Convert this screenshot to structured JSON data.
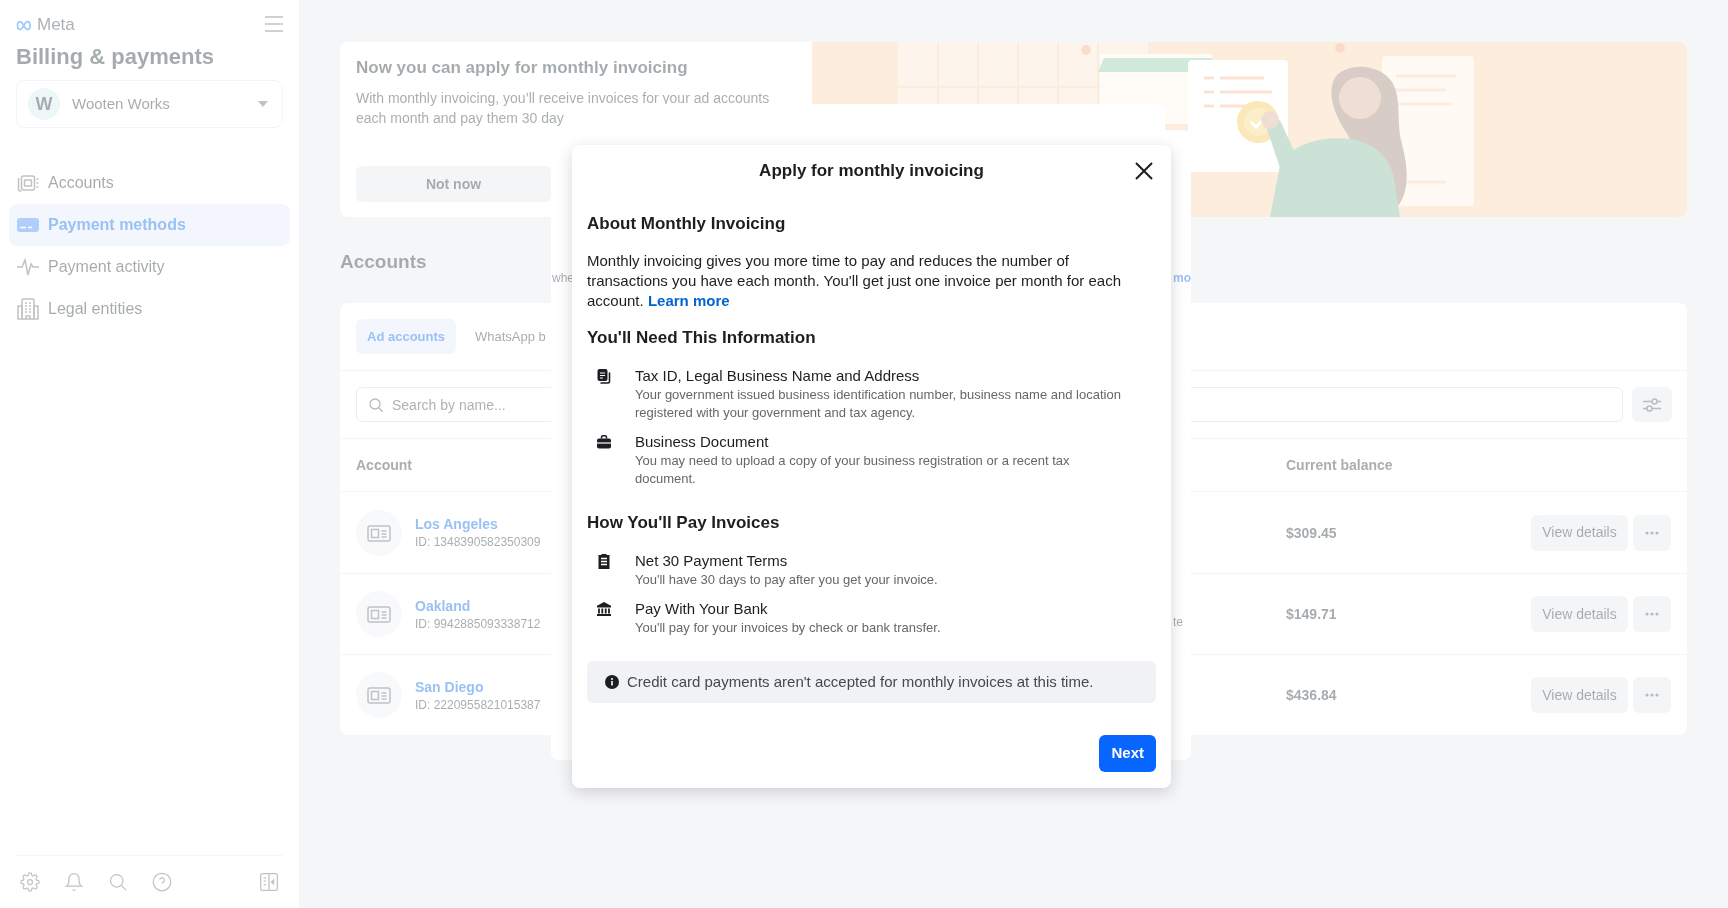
{
  "sidebar": {
    "brand": "Meta",
    "title": "Billing & payments",
    "account_switcher": {
      "avatar_letter": "W",
      "name": "Wooten Works"
    },
    "nav_items": [
      {
        "label": "Accounts",
        "selected": false
      },
      {
        "label": "Payment methods",
        "selected": true
      },
      {
        "label": "Payment activity",
        "selected": false
      },
      {
        "label": "Legal entities",
        "selected": false
      }
    ]
  },
  "banner": {
    "title": "Now you can apply for monthly invoicing",
    "text": "With monthly invoicing, you’ll receive invoices for your ad accounts each month and pay them 30 day",
    "buttons": [
      "Not now"
    ]
  },
  "accounts": {
    "heading": "Accounts",
    "tabs": [
      {
        "label": "Ad accounts",
        "selected": true
      },
      {
        "label": "WhatsApp b",
        "selected": false
      }
    ],
    "search": {
      "placeholder": "Search by name..."
    },
    "table": {
      "columns": [
        "Account",
        "Current balance"
      ],
      "rows": [
        {
          "account": "Los Angeles",
          "id": "ID: 1348390582350309",
          "current_balance": "$309.45",
          "buttons": [
            "View details"
          ]
        },
        {
          "account": "Oakland",
          "id": "ID: 9942885093338712",
          "current_balance": "$149.71",
          "buttons": [
            "View details"
          ]
        },
        {
          "account": "San Diego",
          "id": "ID: 2220955821015387",
          "current_balance": "$436.84",
          "buttons": [
            "View details"
          ]
        }
      ]
    }
  },
  "background_dialog": {
    "fragments": [
      {
        "text": "whe",
        "kind": "text"
      },
      {
        "text": "mo",
        "kind": "link"
      },
      {
        "text": "te",
        "kind": "text"
      }
    ]
  },
  "modal": {
    "title": "Apply for monthly invoicing",
    "sections": [
      {
        "kind": "paragraph",
        "heading": "About Monthly Invoicing",
        "text": "Monthly invoicing gives you more time to pay and reduces the number of transactions you have each month. You'll get just one invoice per month for each account.",
        "link": "Learn more"
      },
      {
        "kind": "list",
        "heading": "You'll Need This Information",
        "items": [
          {
            "title": "Tax ID, Legal Business Name and Address",
            "description": "Your government issued business identification number, business name and location registered with your government and tax agency."
          },
          {
            "title": "Business Document",
            "description": "You may need to upload a copy of your business registration or a recent tax document."
          }
        ]
      },
      {
        "kind": "list",
        "heading": "How You'll Pay Invoices",
        "items": [
          {
            "title": "Net 30 Payment Terms",
            "description": "You'll have 30 days to pay after you get your invoice."
          },
          {
            "title": "Pay With Your Bank",
            "description": "You'll pay for your invoices by check or bank transfer."
          }
        ]
      }
    ],
    "notice": "Credit card payments aren't accepted for monthly invoices at this time.",
    "buttons": [
      "Next"
    ]
  }
}
